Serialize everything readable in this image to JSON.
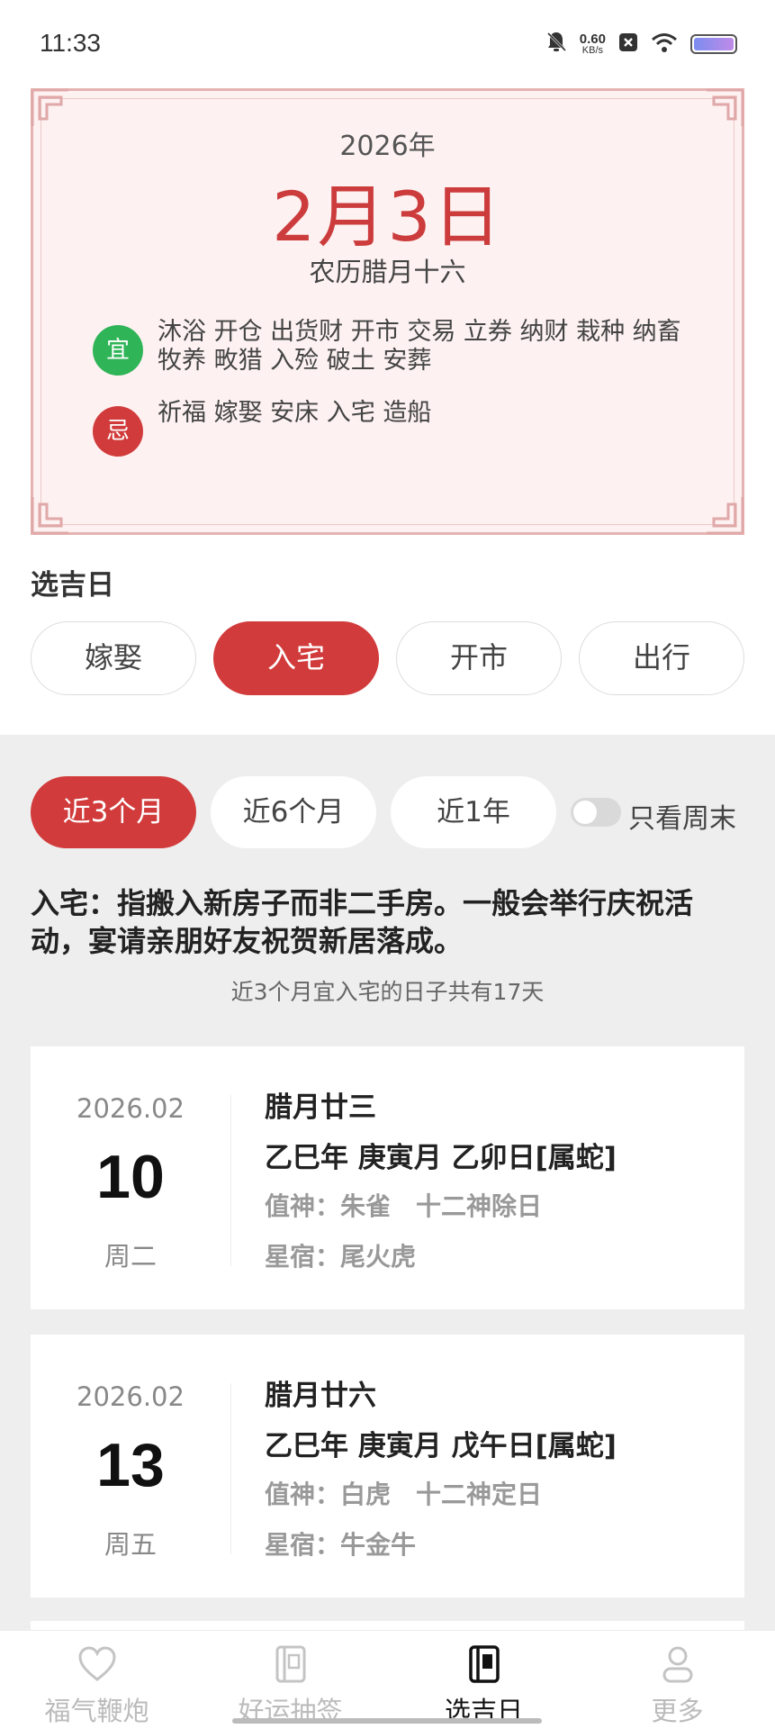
{
  "status_bar": {
    "time": "11:33",
    "net_speed_value": "0.60",
    "net_speed_unit": "KB/s",
    "icons": [
      "mute-bell-icon",
      "close-box-icon",
      "wifi-icon",
      "battery-icon"
    ]
  },
  "almanac": {
    "year": "2026年",
    "date": "2月3日",
    "lunar_date": "农历腊月十六",
    "yi_label": "宜",
    "yi_items": "沐浴 开仓 出货财 开市 交易 立券 纳财 栽种 纳畜 牧养 畋猎 入殓 破土 安葬",
    "ji_label": "忌",
    "ji_items": "祈福 嫁娶 安床 入宅 造船"
  },
  "select_day": {
    "title": "选吉日",
    "event_tabs": [
      {
        "label": "嫁娶",
        "active": false
      },
      {
        "label": "入宅",
        "active": true
      },
      {
        "label": "开市",
        "active": false
      },
      {
        "label": "出行",
        "active": false
      }
    ]
  },
  "filter": {
    "ranges": [
      {
        "label": "近3个月",
        "active": true
      },
      {
        "label": "近6个月",
        "active": false
      },
      {
        "label": "近1年",
        "active": false
      }
    ],
    "weekend_only_label": "只看周末",
    "weekend_only_on": false
  },
  "description": "入宅：指搬入新房子而非二手房。一般会举行庆祝活动，宴请亲朋好友祝贺新居落成。",
  "result_count": "近3个月宜入宅的日子共有17天",
  "days": [
    {
      "year_month": "2026.02",
      "day": "10",
      "weekday": "周二",
      "lunar": "腊月廿三",
      "ganzhi": "乙巳年 庚寅月 乙卯日[属蛇]",
      "zhishen": "值神：朱雀　十二神除日",
      "xingsu": "星宿：尾火虎"
    },
    {
      "year_month": "2026.02",
      "day": "13",
      "weekday": "周五",
      "lunar": "腊月廿六",
      "ganzhi": "乙巳年 庚寅月 戊午日[属蛇]",
      "zhishen": "值神：白虎　十二神定日",
      "xingsu": "星宿：牛金牛"
    }
  ],
  "bottom_nav": [
    {
      "label": "福气鞭炮",
      "icon": "heart-icon",
      "active": false
    },
    {
      "label": "好运抽签",
      "icon": "fortune-stick-icon",
      "active": false
    },
    {
      "label": "选吉日",
      "icon": "calendar-book-icon",
      "active": true
    },
    {
      "label": "更多",
      "icon": "user-icon",
      "active": false
    }
  ],
  "colors": {
    "accent_red": "#d23b3b",
    "date_red": "#cc3c3c",
    "yi_green": "#2fb457",
    "card_bg": "#fdf1f1",
    "panel_gray": "#eeeeee"
  }
}
